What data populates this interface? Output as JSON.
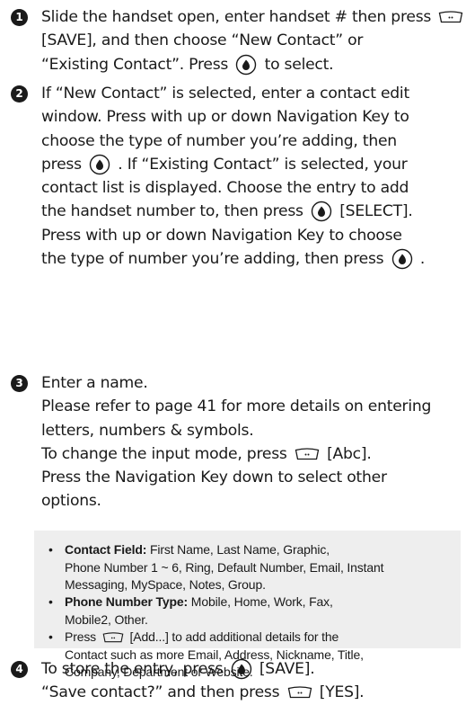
{
  "steps": [
    {
      "number": "1",
      "lines": [
        {
          "parts": [
            "Slide the handset open, enter handset # then press",
            "softkey-icon"
          ]
        },
        {
          "parts": [
            "[SAVE], and then choose “New Contact” or"
          ]
        },
        {
          "parts": [
            "“Existing Contact”. Press",
            "ok-key-icon",
            "to select."
          ]
        }
      ]
    },
    {
      "number": "2",
      "lines": [
        {
          "parts": [
            "If “New Contact” is selected, enter a contact edit"
          ]
        },
        {
          "parts": [
            "window. Press with up or down Navigation Key to"
          ]
        },
        {
          "parts": [
            "choose the type of number you’re adding, then"
          ]
        },
        {
          "parts": [
            "press",
            "ok-key-icon",
            ". If “Existing Contact” is selected, your"
          ]
        },
        {
          "parts": [
            "contact list is displayed. Choose the entry to add"
          ]
        },
        {
          "parts": [
            "the handset number to, then press",
            "ok-key-icon",
            "[SELECT]."
          ]
        },
        {
          "parts": [
            "Press with up or down Navigation Key to choose"
          ]
        },
        {
          "parts": [
            "the type of number you’re adding, then press",
            "ok-key-icon",
            "."
          ]
        }
      ]
    },
    {
      "number": "3",
      "lines": [
        {
          "parts": [
            "Enter a name."
          ]
        },
        {
          "parts": [
            "Please refer to page 41 for more details on entering"
          ]
        },
        {
          "parts": [
            "letters, numbers & symbols."
          ]
        },
        {
          "parts": [
            "To change the input mode, press",
            "softkey-icon",
            "[Abc]."
          ]
        },
        {
          "parts": [
            "Press the Navigation Key down to select other"
          ]
        },
        {
          "parts": [
            "options."
          ]
        }
      ]
    },
    {
      "number": "4",
      "lines": [
        {
          "parts": [
            "To store the entry, press",
            "ok-key-icon",
            "[SAVE]."
          ]
        },
        {
          "parts": [
            "“Save contact?” and then press",
            "softkey-icon",
            "[YES]."
          ]
        }
      ]
    }
  ],
  "note": {
    "items": [
      {
        "bold": "Contact Field:",
        "lines": [
          " First Name, Last Name, Graphic,",
          "Phone Number 1 ~ 6, Ring, Default Number, Email, Instant",
          "Messaging, MySpace, Notes, Group."
        ]
      },
      {
        "bold": "Phone Number Type:",
        "lines": [
          " Mobile, Home, Work, Fax,",
          "Mobile2, Other."
        ]
      },
      {
        "bold": "",
        "lines": [
          "Press [softkey] [Add...] to add additional details for the",
          "Contact such as more Email, Address, Nickname, Title,",
          "Company, Department or Website."
        ]
      }
    ]
  },
  "icons": {
    "softkey": "softkey-icon",
    "ok_key": "ok-key-icon",
    "bullet": "bullet-icon",
    "step_badge": "step-number-badge"
  }
}
